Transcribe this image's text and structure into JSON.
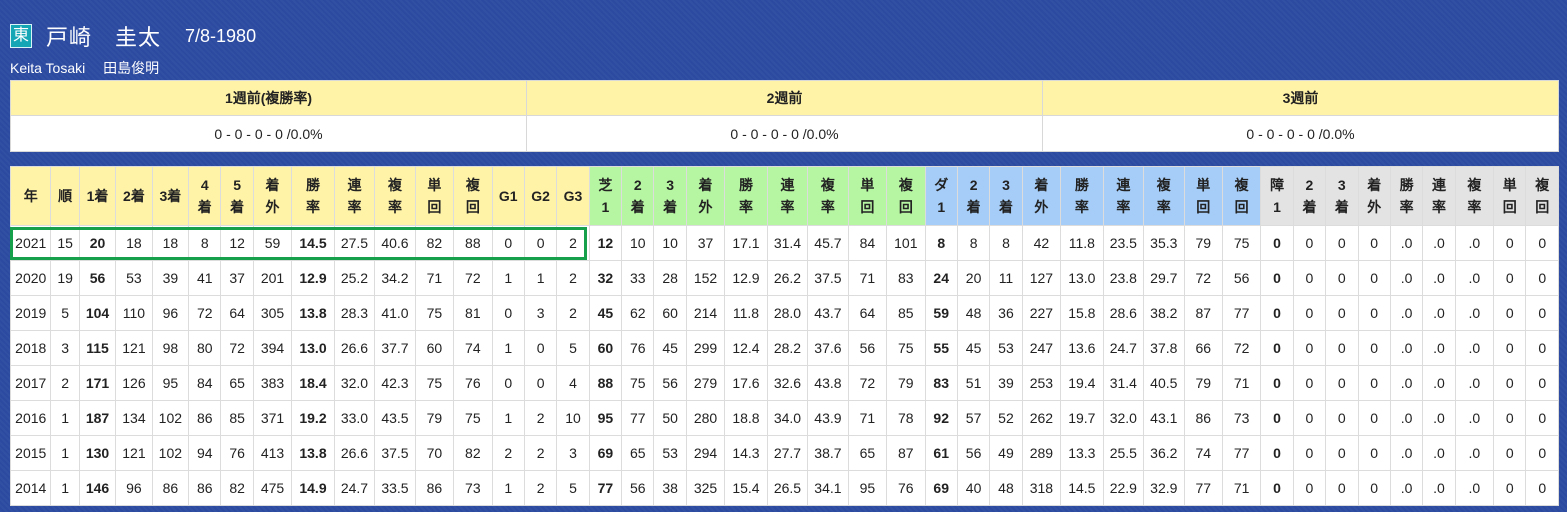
{
  "jockey": {
    "badge": "東",
    "name": "戸崎　圭太",
    "birth": "7/8-1980",
    "romaji": "Keita Tosaki",
    "trainer": "田島俊明"
  },
  "weeks": {
    "headers": [
      "1週前(複勝率)",
      "2週前",
      "3週前"
    ],
    "values": [
      "0 - 0 - 0 - 0 /0.0%",
      "0 - 0 - 0 - 0 /0.0%",
      "0 - 0 - 0 - 0 /0.0%"
    ]
  },
  "stats": {
    "headers": [
      [
        "年"
      ],
      [
        "順"
      ],
      [
        "1着"
      ],
      [
        "2着"
      ],
      [
        "3着"
      ],
      [
        "4",
        "着"
      ],
      [
        "5",
        "着"
      ],
      [
        "着",
        "外"
      ],
      [
        "勝",
        "率"
      ],
      [
        "連",
        "率"
      ],
      [
        "複",
        "率"
      ],
      [
        "単",
        "回"
      ],
      [
        "複",
        "回"
      ],
      [
        "G1"
      ],
      [
        "G2"
      ],
      [
        "G3"
      ],
      [
        "芝",
        "1"
      ],
      [
        "2",
        "着"
      ],
      [
        "3",
        "着"
      ],
      [
        "着",
        "外"
      ],
      [
        "勝",
        "率"
      ],
      [
        "連",
        "率"
      ],
      [
        "複",
        "率"
      ],
      [
        "単",
        "回"
      ],
      [
        "複",
        "回"
      ],
      [
        "ダ",
        "1"
      ],
      [
        "2",
        "着"
      ],
      [
        "3",
        "着"
      ],
      [
        "着",
        "外"
      ],
      [
        "勝",
        "率"
      ],
      [
        "連",
        "率"
      ],
      [
        "複",
        "率"
      ],
      [
        "単",
        "回"
      ],
      [
        "複",
        "回"
      ],
      [
        "障",
        "1"
      ],
      [
        "2",
        "着"
      ],
      [
        "3",
        "着"
      ],
      [
        "着",
        "外"
      ],
      [
        "勝",
        "率"
      ],
      [
        "連",
        "率"
      ],
      [
        "複",
        "率"
      ],
      [
        "単",
        "回"
      ],
      [
        "複",
        "回"
      ]
    ],
    "rows": [
      [
        "2021",
        "15",
        "20",
        "18",
        "18",
        "8",
        "12",
        "59",
        "14.5",
        "27.5",
        "40.6",
        "82",
        "88",
        "0",
        "0",
        "2",
        "12",
        "10",
        "10",
        "37",
        "17.1",
        "31.4",
        "45.7",
        "84",
        "101",
        "8",
        "8",
        "8",
        "42",
        "11.8",
        "23.5",
        "35.3",
        "79",
        "75",
        "0",
        "0",
        "0",
        "0",
        ".0",
        ".0",
        ".0",
        "0",
        "0"
      ],
      [
        "2020",
        "19",
        "56",
        "53",
        "39",
        "41",
        "37",
        "201",
        "12.9",
        "25.2",
        "34.2",
        "71",
        "72",
        "1",
        "1",
        "2",
        "32",
        "33",
        "28",
        "152",
        "12.9",
        "26.2",
        "37.5",
        "71",
        "83",
        "24",
        "20",
        "11",
        "127",
        "13.0",
        "23.8",
        "29.7",
        "72",
        "56",
        "0",
        "0",
        "0",
        "0",
        ".0",
        ".0",
        ".0",
        "0",
        "0"
      ],
      [
        "2019",
        "5",
        "104",
        "110",
        "96",
        "72",
        "64",
        "305",
        "13.8",
        "28.3",
        "41.0",
        "75",
        "81",
        "0",
        "3",
        "2",
        "45",
        "62",
        "60",
        "214",
        "11.8",
        "28.0",
        "43.7",
        "64",
        "85",
        "59",
        "48",
        "36",
        "227",
        "15.8",
        "28.6",
        "38.2",
        "87",
        "77",
        "0",
        "0",
        "0",
        "0",
        ".0",
        ".0",
        ".0",
        "0",
        "0"
      ],
      [
        "2018",
        "3",
        "115",
        "121",
        "98",
        "80",
        "72",
        "394",
        "13.0",
        "26.6",
        "37.7",
        "60",
        "74",
        "1",
        "0",
        "5",
        "60",
        "76",
        "45",
        "299",
        "12.4",
        "28.2",
        "37.6",
        "56",
        "75",
        "55",
        "45",
        "53",
        "247",
        "13.6",
        "24.7",
        "37.8",
        "66",
        "72",
        "0",
        "0",
        "0",
        "0",
        ".0",
        ".0",
        ".0",
        "0",
        "0"
      ],
      [
        "2017",
        "2",
        "171",
        "126",
        "95",
        "84",
        "65",
        "383",
        "18.4",
        "32.0",
        "42.3",
        "75",
        "76",
        "0",
        "0",
        "4",
        "88",
        "75",
        "56",
        "279",
        "17.6",
        "32.6",
        "43.8",
        "72",
        "79",
        "83",
        "51",
        "39",
        "253",
        "19.4",
        "31.4",
        "40.5",
        "79",
        "71",
        "0",
        "0",
        "0",
        "0",
        ".0",
        ".0",
        ".0",
        "0",
        "0"
      ],
      [
        "2016",
        "1",
        "187",
        "134",
        "102",
        "86",
        "85",
        "371",
        "19.2",
        "33.0",
        "43.5",
        "79",
        "75",
        "1",
        "2",
        "10",
        "95",
        "77",
        "50",
        "280",
        "18.8",
        "34.0",
        "43.9",
        "71",
        "78",
        "92",
        "57",
        "52",
        "262",
        "19.7",
        "32.0",
        "43.1",
        "86",
        "73",
        "0",
        "0",
        "0",
        "0",
        ".0",
        ".0",
        ".0",
        "0",
        "0"
      ],
      [
        "2015",
        "1",
        "130",
        "121",
        "102",
        "94",
        "76",
        "413",
        "13.8",
        "26.6",
        "37.5",
        "70",
        "82",
        "2",
        "2",
        "3",
        "69",
        "65",
        "53",
        "294",
        "14.3",
        "27.7",
        "38.7",
        "65",
        "87",
        "61",
        "56",
        "49",
        "289",
        "13.3",
        "25.5",
        "36.2",
        "74",
        "77",
        "0",
        "0",
        "0",
        "0",
        ".0",
        ".0",
        ".0",
        "0",
        "0"
      ],
      [
        "2014",
        "1",
        "146",
        "96",
        "86",
        "86",
        "82",
        "475",
        "14.9",
        "24.7",
        "33.5",
        "86",
        "73",
        "1",
        "2",
        "5",
        "77",
        "56",
        "38",
        "325",
        "15.4",
        "26.5",
        "34.1",
        "95",
        "76",
        "69",
        "40",
        "48",
        "318",
        "14.5",
        "22.9",
        "32.9",
        "77",
        "71",
        "0",
        "0",
        "0",
        "0",
        ".0",
        ".0",
        ".0",
        "0",
        "0"
      ]
    ]
  },
  "colors": {
    "background": "#2b4aa0",
    "yellow": "#fff3a8",
    "green": "#b6f5a2",
    "blue": "#a6cdf7",
    "gray": "#e3e3e3",
    "highlight": "#16a04c"
  }
}
